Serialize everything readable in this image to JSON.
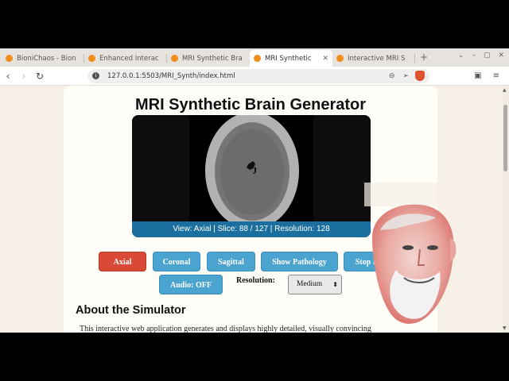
{
  "browser": {
    "tabs": [
      {
        "label": "BioniChaos - Bion"
      },
      {
        "label": "Enhanced Interac"
      },
      {
        "label": "MRI Synthetic Bra"
      },
      {
        "label": "MRI Synthetic",
        "active": true
      },
      {
        "label": "Interactive MRI S"
      }
    ],
    "new_tab": "+",
    "window_controls": [
      "⌄",
      "–",
      "▢",
      "✕"
    ],
    "url": "127.0.0.1:5503/MRI_Synth/index.html"
  },
  "page": {
    "title": "MRI Synthetic Brain Generator",
    "viewer_caption": "View: Axial | Slice: 88 / 127 | Resolution: 128",
    "buttons": {
      "axial": "Axial",
      "coronal": "Coronal",
      "sagittal": "Sagittal",
      "show_pathology": "Show Pathology",
      "stop_rotate": "Stop Rotate",
      "audio": "Audio: OFF"
    },
    "active_view": "Axial",
    "resolution_label": "Resolution:",
    "resolution_value": "Medium",
    "about_heading": "About the Simulator",
    "about_text": "This interactive web application generates and displays highly detailed, visually convincing"
  },
  "colors": {
    "active_button": "#d84a35",
    "button": "#4ba3cf",
    "caption_bar": "#1b6f9e",
    "page_bg": "#f7f0e6"
  },
  "icons": [
    "firefox-favicon",
    "back-icon",
    "forward-icon",
    "reload-icon",
    "info-icon",
    "zoom-icon",
    "send-icon",
    "brave-shield-icon",
    "reader-icon",
    "menu-icon"
  ]
}
